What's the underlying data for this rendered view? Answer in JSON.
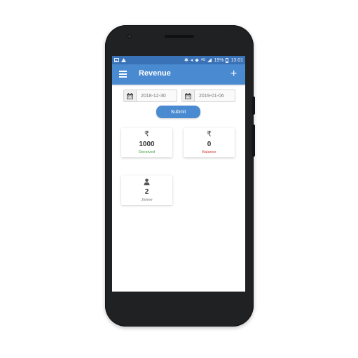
{
  "status_bar": {
    "left_icons": [
      "image-icon",
      "warning-icon"
    ],
    "signal_text": "4G",
    "battery": "19%",
    "time": "13:01"
  },
  "app_bar": {
    "title": "Revenue",
    "menu_icon": "hamburger-menu-icon",
    "add_icon": "plus-icon"
  },
  "filters": {
    "from_date": "2018-12-30",
    "to_date": "2019-01-06",
    "submit_label": "Submit"
  },
  "cards": {
    "received": {
      "icon": "rupee-icon",
      "symbol": "₹",
      "value": "1000",
      "label": "Received"
    },
    "balance": {
      "icon": "rupee-icon",
      "symbol": "₹",
      "value": "0",
      "label": "Balance"
    },
    "joinee": {
      "icon": "person-icon",
      "value": "2",
      "label": "Joinee"
    }
  },
  "colors": {
    "app_bar": "#4a8ad0",
    "status_bar": "#3a72b8",
    "received_label": "#3ca046",
    "balance_label": "#d63a32"
  }
}
